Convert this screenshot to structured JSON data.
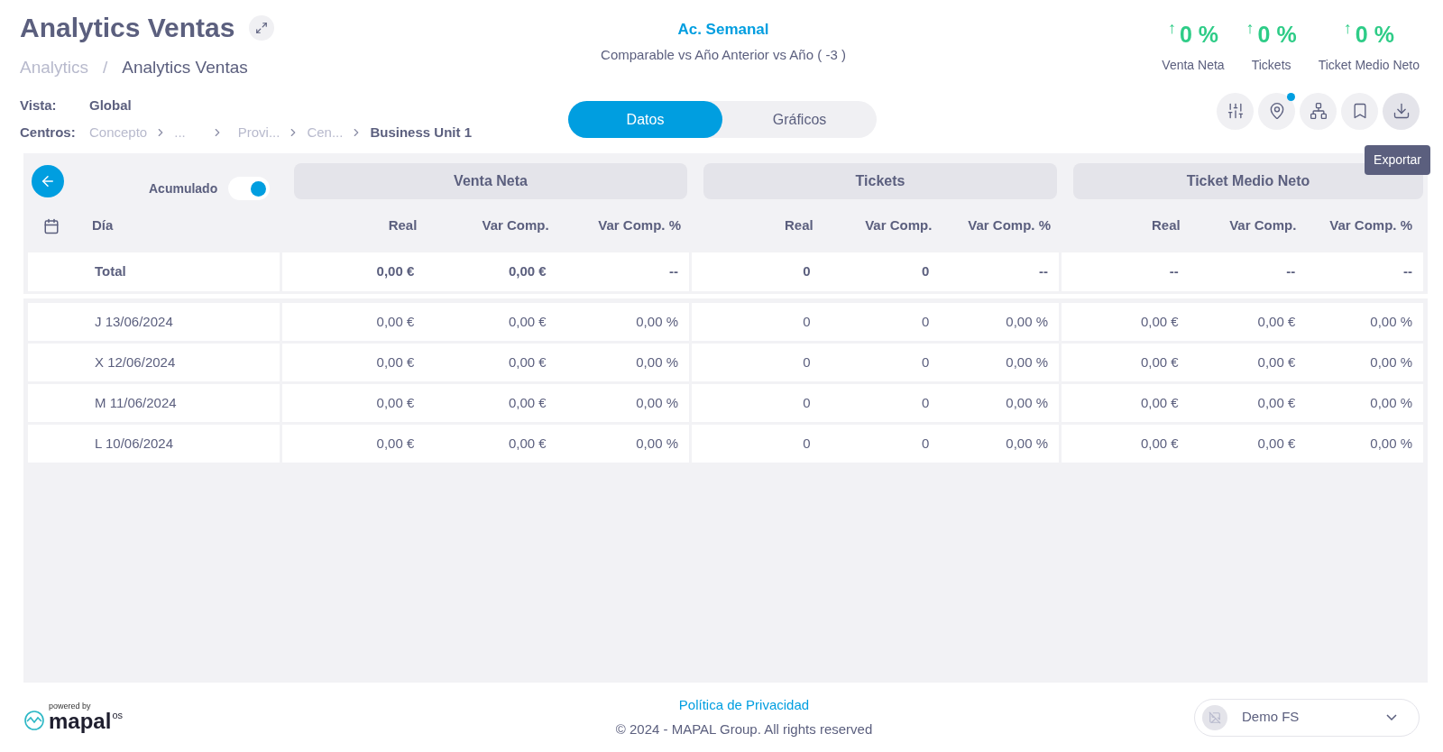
{
  "header": {
    "title": "Analytics Ventas",
    "breadcrumb": [
      {
        "label": "Analytics",
        "current": false
      },
      {
        "label": "Analytics Ventas",
        "current": true
      }
    ],
    "breadcrumb_separator": "/",
    "vista_label": "Vista:",
    "vista_value": "Global",
    "centros_label": "Centros:",
    "centros_path": [
      {
        "label": "Concepto",
        "current": false
      },
      {
        "label": "...",
        "current": false
      },
      {
        "label": "Provi...",
        "current": false
      },
      {
        "label": "Cen...",
        "current": false
      },
      {
        "label": "Business Unit 1",
        "current": true
      }
    ]
  },
  "period": {
    "title": "Ac. Semanal",
    "subtitle": "Comparable vs Año Anterior vs Año ( -3 )"
  },
  "kpis": [
    {
      "arrow": "↑",
      "value": "0 %",
      "label": "Venta Neta"
    },
    {
      "arrow": "↑",
      "value": "0 %",
      "label": "Tickets"
    },
    {
      "arrow": "↑",
      "value": "0 %",
      "label": "Ticket Medio Neto"
    }
  ],
  "tabs": [
    {
      "label": "Datos",
      "selected": true
    },
    {
      "label": "Gráficos",
      "selected": false
    }
  ],
  "toolbar": [
    {
      "kind": "filters",
      "badge": false
    },
    {
      "kind": "location",
      "badge": true
    },
    {
      "kind": "hierarchy",
      "badge": false
    },
    {
      "kind": "bookmark",
      "badge": false
    },
    {
      "kind": "download",
      "badge": false,
      "tooltip": "Exportar"
    }
  ],
  "table": {
    "accumulated_label": "Acumulado",
    "accumulated_on": true,
    "groups": [
      {
        "title": "Venta Neta",
        "sub_columns": [
          "Real",
          "Var Comp.",
          "Var Comp. %"
        ]
      },
      {
        "title": "Tickets",
        "sub_columns": [
          "Real",
          "Var Comp.",
          "Var Comp. %"
        ]
      },
      {
        "title": "Ticket Medio Neto",
        "sub_columns": [
          "Real",
          "Var Comp.",
          "Var Comp. %"
        ]
      }
    ],
    "day_column": "Día",
    "total": {
      "label": "Total",
      "cells": [
        [
          "0,00 €",
          "0,00 €",
          "--"
        ],
        [
          "0",
          "0",
          "--"
        ],
        [
          "--",
          "--",
          "--"
        ]
      ]
    },
    "rows": [
      {
        "day": "J 13/06/2024",
        "cells": [
          [
            "0,00 €",
            "0,00 €",
            "0,00 %"
          ],
          [
            "0",
            "0",
            "0,00 %"
          ],
          [
            "0,00 €",
            "0,00 €",
            "0,00 %"
          ]
        ]
      },
      {
        "day": "X 12/06/2024",
        "cells": [
          [
            "0,00 €",
            "0,00 €",
            "0,00 %"
          ],
          [
            "0",
            "0",
            "0,00 %"
          ],
          [
            "0,00 €",
            "0,00 €",
            "0,00 %"
          ]
        ]
      },
      {
        "day": "M 11/06/2024",
        "cells": [
          [
            "0,00 €",
            "0,00 €",
            "0,00 %"
          ],
          [
            "0",
            "0",
            "0,00 %"
          ],
          [
            "0,00 €",
            "0,00 €",
            "0,00 %"
          ]
        ]
      },
      {
        "day": "L 10/06/2024",
        "cells": [
          [
            "0,00 €",
            "0,00 €",
            "0,00 %"
          ],
          [
            "0",
            "0",
            "0,00 %"
          ],
          [
            "0,00 €",
            "0,00 €",
            "0,00 %"
          ]
        ]
      }
    ]
  },
  "footer": {
    "powered_by": "powered by",
    "brand": "mapal",
    "brand_suffix": "os",
    "privacy_link": "Política de Privacidad",
    "copyright": "© 2024 - MAPAL Group. All rights reserved",
    "account": "Demo FS"
  }
}
